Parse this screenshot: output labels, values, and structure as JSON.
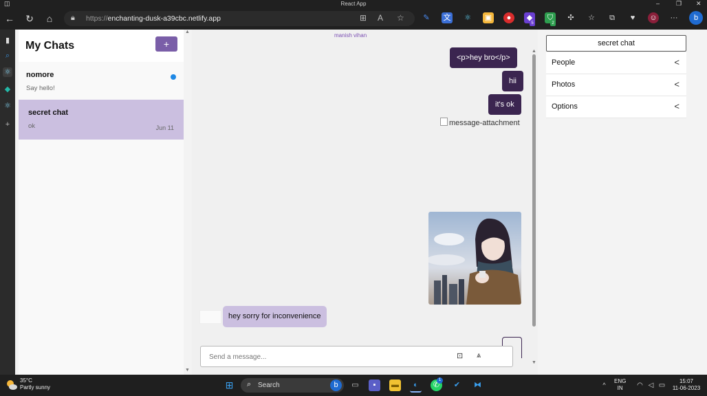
{
  "window": {
    "title": "React App",
    "minimize": "–",
    "maximize": "❐",
    "close": "✕"
  },
  "browser": {
    "url_scheme": "https://",
    "url_host": "enchanting-dusk-a39cbc.netlify.app",
    "icons": [
      "back-icon",
      "refresh-icon",
      "home-icon",
      "lock-icon",
      "apps-icon",
      "read-aloud-icon",
      "favorite-icon"
    ],
    "extension_badges": {
      "ext_purple": "5",
      "ext_green": "2"
    },
    "more_label": "···"
  },
  "chat_list": {
    "title": "My Chats",
    "new_chat_label": "+",
    "items": [
      {
        "name": "nomore",
        "preview": "Say hello!",
        "date": "",
        "unread": true,
        "active": false
      },
      {
        "name": "secret chat",
        "preview": "ok",
        "date": "Jun 11",
        "unread": false,
        "active": true
      }
    ]
  },
  "conversation": {
    "sender_label": "manish vihan",
    "messages_out": [
      {
        "text": "<p>hey bro</p>"
      },
      {
        "text": "hii"
      },
      {
        "text": "it's ok"
      }
    ],
    "attachment_alt": "message-attachment",
    "message_in": "hey sorry for inconvenience",
    "composer": {
      "placeholder": "Send a message..."
    }
  },
  "details": {
    "chat_title": "secret chat",
    "sections": [
      {
        "label": "People"
      },
      {
        "label": "Photos"
      },
      {
        "label": "Options"
      }
    ],
    "chevron": "<"
  },
  "taskbar": {
    "weather_temp": "35°C",
    "weather_desc": "Partly sunny",
    "search_label": "Search",
    "notification_badge": "1",
    "lang_top": "ENG",
    "lang_bottom": "IN",
    "time": "15:07",
    "date": "11-06-2023"
  },
  "colors": {
    "accent": "#7a5ea8",
    "outgoing_bubble": "#3b2550",
    "incoming_bubble": "#cbbfe0",
    "active_chat": "#cbbfe0",
    "unread_dot": "#1e88e5"
  }
}
